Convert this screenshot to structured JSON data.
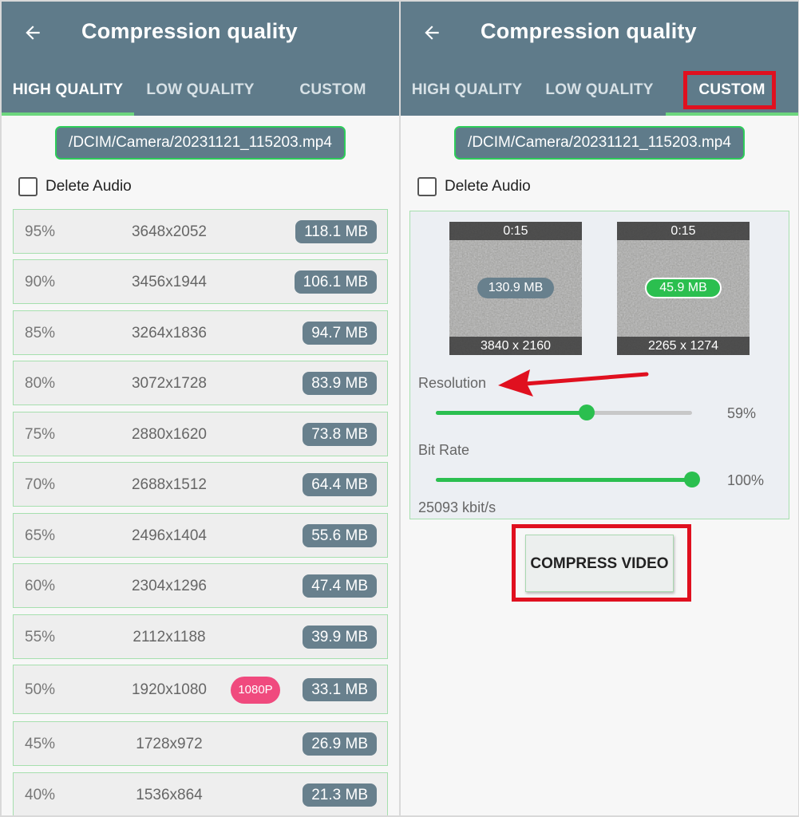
{
  "appbar": {
    "title": "Compression quality"
  },
  "tabs": [
    "HIGH QUALITY",
    "LOW QUALITY",
    "CUSTOM"
  ],
  "file_path": "/DCIM/Camera/20231121_115203.mp4",
  "delete_audio_label": "Delete Audio",
  "quality_list": [
    {
      "percent": "95%",
      "resolution": "3648x2052",
      "size": "118.1 MB"
    },
    {
      "percent": "90%",
      "resolution": "3456x1944",
      "size": "106.1 MB"
    },
    {
      "percent": "85%",
      "resolution": "3264x1836",
      "size": "94.7 MB"
    },
    {
      "percent": "80%",
      "resolution": "3072x1728",
      "size": "83.9 MB"
    },
    {
      "percent": "75%",
      "resolution": "2880x1620",
      "size": "73.8 MB"
    },
    {
      "percent": "70%",
      "resolution": "2688x1512",
      "size": "64.4 MB"
    },
    {
      "percent": "65%",
      "resolution": "2496x1404",
      "size": "55.6 MB"
    },
    {
      "percent": "60%",
      "resolution": "2304x1296",
      "size": "47.4 MB"
    },
    {
      "percent": "55%",
      "resolution": "2112x1188",
      "size": "39.9 MB"
    },
    {
      "percent": "50%",
      "resolution": "1920x1080",
      "size": "33.1 MB",
      "badge": "1080P"
    },
    {
      "percent": "45%",
      "resolution": "1728x972",
      "size": "26.9 MB"
    },
    {
      "percent": "40%",
      "resolution": "1536x864",
      "size": "21.3 MB"
    }
  ],
  "custom": {
    "original": {
      "duration": "0:15",
      "size": "130.9 MB",
      "resolution": "3840 x 2160"
    },
    "compressed": {
      "duration": "0:15",
      "size": "45.9 MB",
      "resolution": "2265 x 1274"
    },
    "resolution_label": "Resolution",
    "resolution_value": "59%",
    "resolution_fraction": 0.59,
    "bitrate_label": "Bit Rate",
    "bitrate_value": "100%",
    "bitrate_fraction": 1.0,
    "bitrate_text": "25093 kbit/s",
    "compress_button": "COMPRESS VIDEO"
  },
  "colors": {
    "appbar": "#5f7b8a",
    "accent_green": "#2bbf4f",
    "size_pill": "#68808d",
    "badge_pink": "#f04a7e",
    "highlight_red": "#e0101f"
  }
}
